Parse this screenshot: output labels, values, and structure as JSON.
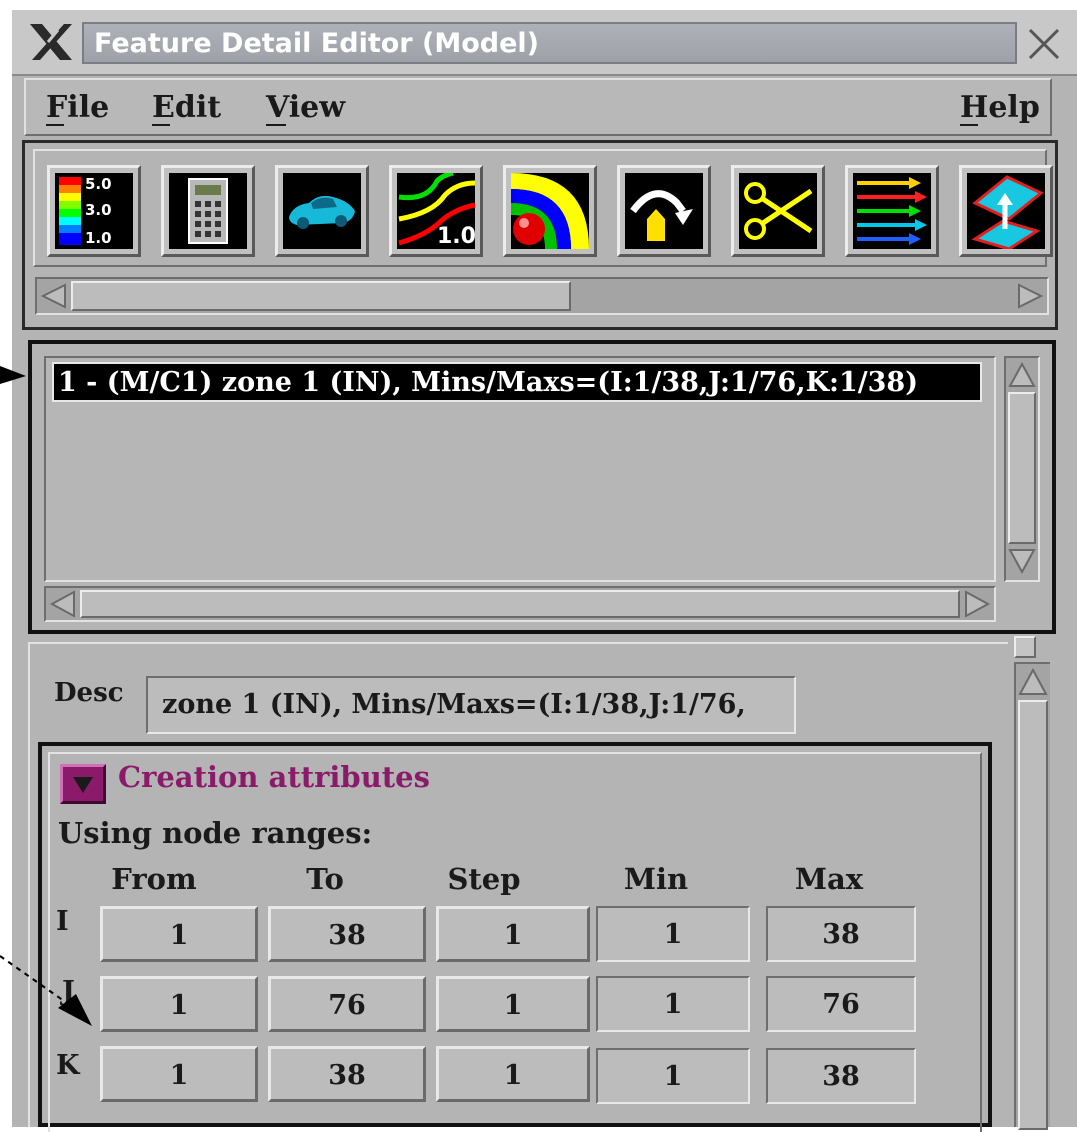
{
  "window": {
    "title": "Feature Detail Editor (Model)"
  },
  "menubar": {
    "file": "File",
    "edit": "Edit",
    "view": "View",
    "help": "Help"
  },
  "toolbar": {
    "icons": [
      "legend-icon",
      "calculator-icon",
      "car-model-icon",
      "contour-icon",
      "isosurface-icon",
      "particle-trace-icon",
      "clip-icon",
      "vector-arrows-icon",
      "elevated-surface-icon"
    ],
    "legend_values": [
      "5.0",
      "3.0",
      "1.0"
    ],
    "contour_value": "1.0"
  },
  "part_list": {
    "items": [
      "1 - (M/C1) zone 1 (IN), Mins/Maxs=(I:1/38,J:1/76,K:1/38)"
    ]
  },
  "desc": {
    "label": "Desc",
    "value": "zone 1 (IN), Mins/Maxs=(I:1/38,J:1/76,"
  },
  "creation": {
    "title": "Creation attributes",
    "using_label": "Using node ranges:",
    "columns": [
      "From",
      "To",
      "Step",
      "Min",
      "Max"
    ],
    "rows": [
      {
        "label": "I",
        "from": "1",
        "to": "38",
        "step": "1",
        "min": "1",
        "max": "38"
      },
      {
        "label": "J",
        "from": "1",
        "to": "76",
        "step": "1",
        "min": "1",
        "max": "76"
      },
      {
        "label": "K",
        "from": "1",
        "to": "38",
        "step": "1",
        "min": "1",
        "max": "38"
      }
    ]
  }
}
